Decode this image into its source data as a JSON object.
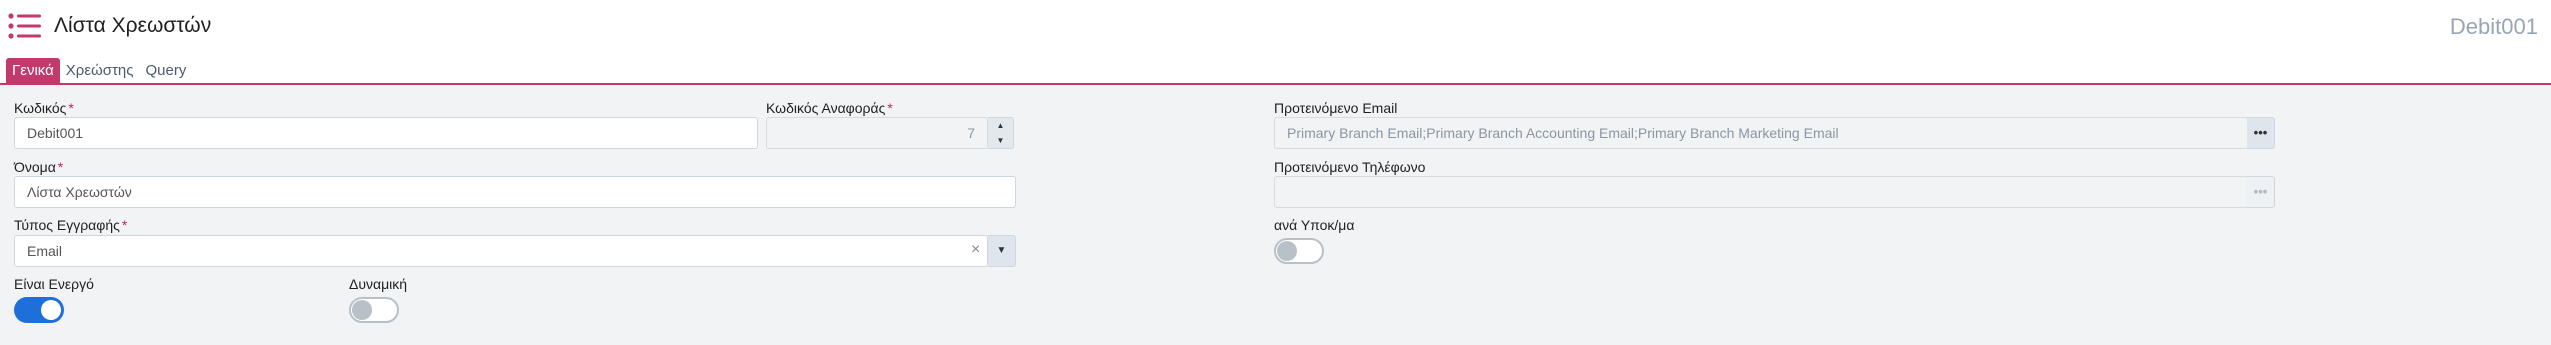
{
  "header": {
    "title": "Λίστα Χρεωστών",
    "record_id": "Debit001"
  },
  "tabs": [
    {
      "label": "Γενικά",
      "active": true
    },
    {
      "label": "Χρεώστης",
      "active": false
    },
    {
      "label": "Query",
      "active": false
    }
  ],
  "form": {
    "code": {
      "label": "Κωδικός",
      "required": "*",
      "value": "Debit001"
    },
    "reference_code": {
      "label": "Κωδικός Αναφοράς",
      "required": "*",
      "value": "7",
      "up": "▲",
      "down": "▼"
    },
    "preferred_email": {
      "label": "Προτεινόμενο Email",
      "value": "Primary Branch Email;Primary Branch Accounting Email;Primary Branch Marketing Email",
      "button": "•••"
    },
    "name": {
      "label": "Όνομα",
      "required": "*",
      "value": "Λίστα Χρεωστών"
    },
    "preferred_phone": {
      "label": "Προτεινόμενο Τηλέφωνο",
      "value": "",
      "button": "•••"
    },
    "record_type": {
      "label": "Τύπος Εγγραφής",
      "required": "*",
      "value": "Email",
      "clear": "×",
      "caret": "▼"
    },
    "per_branch": {
      "label": "ανά Υποκ/μα",
      "checked": false
    },
    "is_active": {
      "label": "Είναι Ενεργό",
      "checked": true
    },
    "dynamic": {
      "label": "Δυναμική",
      "checked": false
    }
  },
  "colors": {
    "accent": "#c23a6b",
    "toggle_on": "#1e6fd9",
    "required": "#c7254e",
    "record_id": "#98a6b4"
  },
  "icons": {
    "menu": "list-menu-icon"
  }
}
